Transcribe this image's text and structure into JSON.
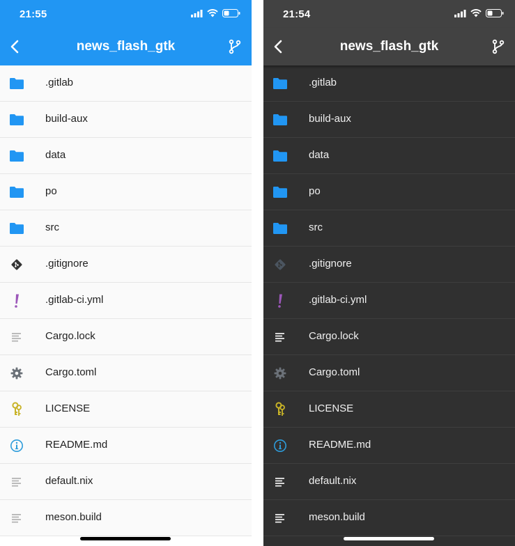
{
  "colors": {
    "light_appbar": "#2196f3",
    "dark_appbar": "#424242",
    "dark_background": "#303030",
    "folder_blue": "#2196f3",
    "exclamation_purple": "#9c57b9",
    "key_yellow": "#c8b327",
    "info_blue": "#2d9cdb",
    "gear_gray": "#6b7178"
  },
  "light": {
    "time": "21:55",
    "title": "news_flash_gtk"
  },
  "dark": {
    "time": "21:54",
    "title": "news_flash_gtk"
  },
  "files": [
    {
      "name": ".gitlab",
      "icon": "folder-icon"
    },
    {
      "name": "build-aux",
      "icon": "folder-icon"
    },
    {
      "name": "data",
      "icon": "folder-icon"
    },
    {
      "name": "po",
      "icon": "folder-icon"
    },
    {
      "name": "src",
      "icon": "folder-icon"
    },
    {
      "name": ".gitignore",
      "icon": "git-icon"
    },
    {
      "name": ".gitlab-ci.yml",
      "icon": "exclamation-icon"
    },
    {
      "name": "Cargo.lock",
      "icon": "text-file-icon"
    },
    {
      "name": "Cargo.toml",
      "icon": "gear-icon"
    },
    {
      "name": "LICENSE",
      "icon": "key-icon"
    },
    {
      "name": "README.md",
      "icon": "info-icon"
    },
    {
      "name": "default.nix",
      "icon": "text-file-icon"
    },
    {
      "name": "meson.build",
      "icon": "text-file-icon"
    }
  ]
}
